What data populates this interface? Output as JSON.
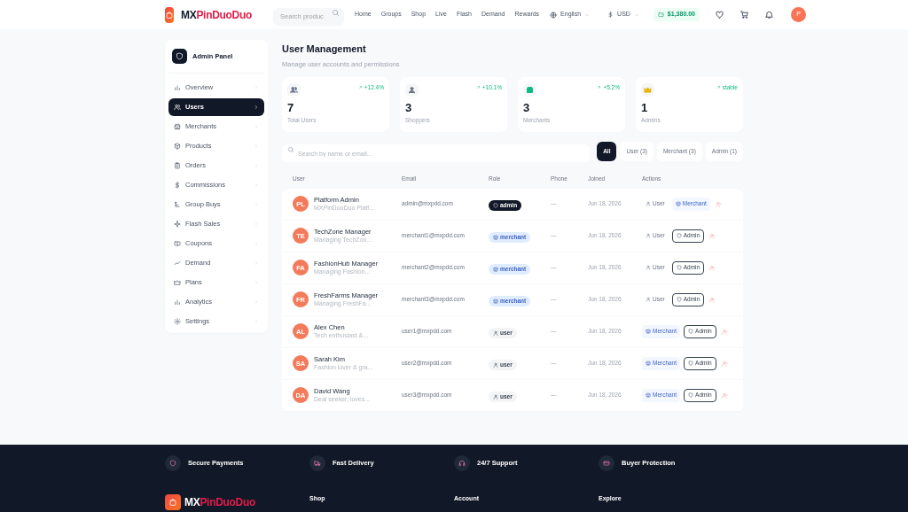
{
  "header": {
    "brand_prefix": "MX",
    "brand_suffix": "PinDuoDuo",
    "search": {
      "placeholder": "Search produc"
    },
    "nav": [
      "Home",
      "Groups",
      "Shop",
      "Live",
      "Flash",
      "Demand",
      "Rewards"
    ],
    "language": "English",
    "currency": "USD",
    "balance": "$1,380.00",
    "avatar": "P"
  },
  "sidebar": {
    "title": "Admin Panel",
    "items": [
      {
        "label": "Overview",
        "selected": false
      },
      {
        "label": "Users",
        "selected": true
      },
      {
        "label": "Merchants",
        "selected": false
      },
      {
        "label": "Products",
        "selected": false
      },
      {
        "label": "Orders",
        "selected": false
      },
      {
        "label": "Commissions",
        "selected": false
      },
      {
        "label": "Group Buys",
        "selected": false
      },
      {
        "label": "Flash Sales",
        "selected": false
      },
      {
        "label": "Coupons",
        "selected": false
      },
      {
        "label": "Demand",
        "selected": false
      },
      {
        "label": "Plans",
        "selected": false
      },
      {
        "label": "Analytics",
        "selected": false
      },
      {
        "label": "Settings",
        "selected": false
      }
    ]
  },
  "page": {
    "title": "User Management",
    "subtitle": "Manage user accounts and permissions"
  },
  "stats": [
    {
      "value": "7",
      "label": "Total Users",
      "change": "+12.4%",
      "color": "#64748b"
    },
    {
      "value": "3",
      "label": "Shoppers",
      "change": "+10.1%",
      "color": "#6b7280"
    },
    {
      "value": "3",
      "label": "Merchants",
      "change": "+5.2%",
      "color": "#10b981"
    },
    {
      "value": "1",
      "label": "Admins",
      "change": "stable",
      "color": "#eab308"
    }
  ],
  "search": {
    "placeholder": "Search by name or email..."
  },
  "filters": [
    {
      "label": "All",
      "selected": true
    },
    {
      "label": "User (3)",
      "selected": false
    },
    {
      "label": "Merchant (3)",
      "selected": false
    },
    {
      "label": "Admin (1)",
      "selected": false
    }
  ],
  "table": {
    "columns": [
      "User",
      "Email",
      "Role",
      "Phone",
      "Joined",
      "Actions"
    ],
    "rows": [
      {
        "initials": "PL",
        "name": "Platform Admin",
        "bio": "MXPinDuoDuo Platf...",
        "email": "admin@mxpdd.com",
        "role": "admin",
        "phone": "—",
        "joined": "Jun 18, 2026",
        "actions": [
          {
            "label": "User",
            "kind": "user"
          },
          {
            "label": "Merchant",
            "kind": "merchant"
          }
        ]
      },
      {
        "initials": "TE",
        "name": "TechZone Manager",
        "bio": "Managing TechZon...",
        "email": "merchant1@mxpdd.com",
        "role": "merchant",
        "phone": "—",
        "joined": "Jun 18, 2026",
        "actions": [
          {
            "label": "User",
            "kind": "user"
          },
          {
            "label": "Admin",
            "kind": "admin"
          }
        ]
      },
      {
        "initials": "FA",
        "name": "FashionHub Manager",
        "bio": "Managing Fashion...",
        "email": "merchant2@mxpdd.com",
        "role": "merchant",
        "phone": "—",
        "joined": "Jun 18, 2026",
        "actions": [
          {
            "label": "User",
            "kind": "user"
          },
          {
            "label": "Admin",
            "kind": "admin"
          }
        ]
      },
      {
        "initials": "FR",
        "name": "FreshFarms Manager",
        "bio": "Managing FreshFa...",
        "email": "merchant3@mxpdd.com",
        "role": "merchant",
        "phone": "—",
        "joined": "Jun 18, 2026",
        "actions": [
          {
            "label": "User",
            "kind": "user"
          },
          {
            "label": "Admin",
            "kind": "admin"
          }
        ]
      },
      {
        "initials": "AL",
        "name": "Alex Chen",
        "bio": "Tech enthusiast &...",
        "email": "user1@mxpdd.com",
        "role": "user",
        "phone": "—",
        "joined": "Jun 18, 2026",
        "actions": [
          {
            "label": "Merchant",
            "kind": "merchant"
          },
          {
            "label": "Admin",
            "kind": "admin"
          }
        ]
      },
      {
        "initials": "SA",
        "name": "Sarah Kim",
        "bio": "Fashion lover & gra...",
        "email": "user2@mxpdd.com",
        "role": "user",
        "phone": "—",
        "joined": "Jun 18, 2026",
        "actions": [
          {
            "label": "Merchant",
            "kind": "merchant"
          },
          {
            "label": "Admin",
            "kind": "admin"
          }
        ]
      },
      {
        "initials": "DA",
        "name": "David Wang",
        "bio": "Deal seeker, loves...",
        "email": "user3@mxpdd.com",
        "role": "user",
        "phone": "—",
        "joined": "Jun 18, 2026",
        "actions": [
          {
            "label": "Merchant",
            "kind": "merchant"
          },
          {
            "label": "Admin",
            "kind": "admin"
          }
        ]
      }
    ]
  },
  "footer": {
    "features": [
      "Secure Payments",
      "Fast Delivery",
      "24/7 Support",
      "Buyer Protection"
    ],
    "brand_prefix": "MX",
    "brand_suffix": "PinDuoDuo",
    "columns": [
      "Shop",
      "Account",
      "Explore"
    ]
  }
}
